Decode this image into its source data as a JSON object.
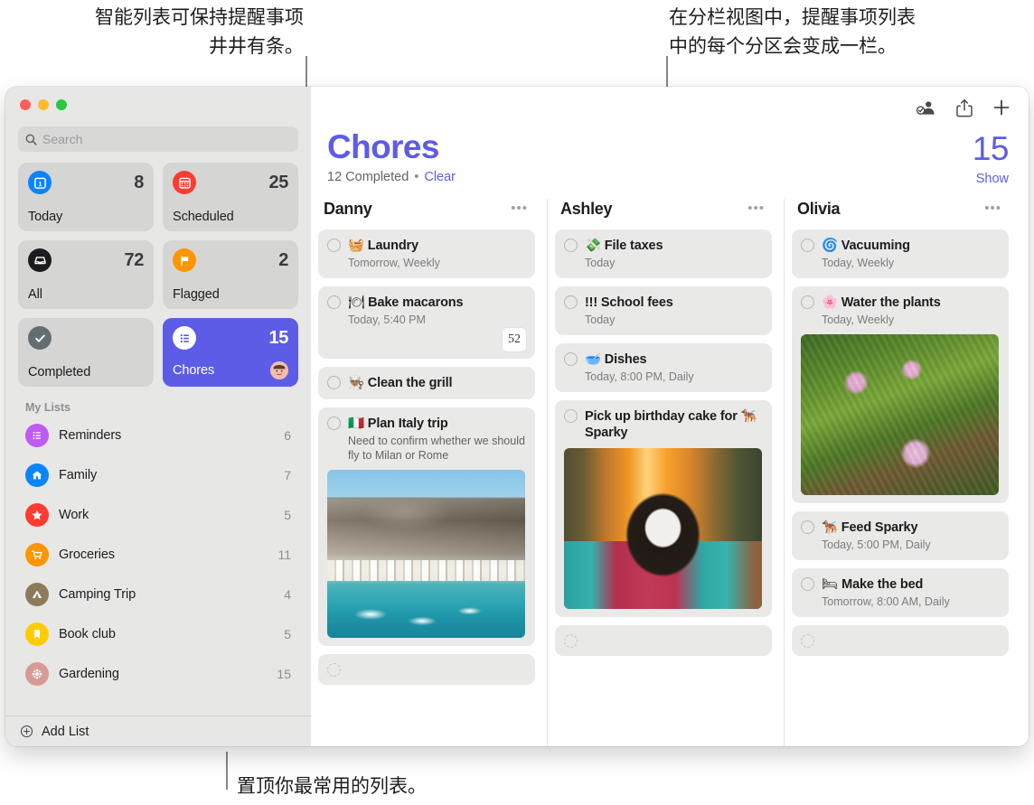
{
  "annotations": {
    "top_left": "智能列表可保持提醒事项\n井井有条。",
    "top_right": "在分栏视图中，提醒事项列表\n中的每个分区会变成一栏。",
    "bottom": "置顶你最常用的列表。"
  },
  "colors": {
    "accent": "#5D5CE6",
    "sidebar_bg": "#E7E7E5",
    "card_bg": "#E9E9E7"
  },
  "sidebar": {
    "search": {
      "placeholder": "Search",
      "value": "",
      "icon": "search-icon"
    },
    "smart_lists": [
      {
        "label": "Today",
        "count": "8",
        "icon": "calendar-day-icon",
        "color": "#0a84ff",
        "selected": false
      },
      {
        "label": "Scheduled",
        "count": "25",
        "icon": "calendar-icon",
        "color": "#ff3b30",
        "selected": false
      },
      {
        "label": "All",
        "count": "72",
        "icon": "tray-icon",
        "color": "#1c1c1e",
        "selected": false
      },
      {
        "label": "Flagged",
        "count": "2",
        "icon": "flag-icon",
        "color": "#ff9500",
        "selected": false
      },
      {
        "label": "Completed",
        "count": "",
        "icon": "checkmark-icon",
        "color": "#636e72",
        "selected": false
      },
      {
        "label": "Chores",
        "count": "15",
        "icon": "list-bullet-icon",
        "color": "#ffffff",
        "selected": true,
        "avatar": "shared-avatar"
      }
    ],
    "my_lists_header": "My Lists",
    "my_lists": [
      {
        "label": "Reminders",
        "count": "6",
        "icon": "list-bullet-icon",
        "color": "#bf5af2"
      },
      {
        "label": "Family",
        "count": "7",
        "icon": "house-icon",
        "color": "#0a84ff"
      },
      {
        "label": "Work",
        "count": "5",
        "icon": "star-icon",
        "color": "#ff3b30"
      },
      {
        "label": "Groceries",
        "count": "11",
        "icon": "cart-icon",
        "color": "#ff9500"
      },
      {
        "label": "Camping Trip",
        "count": "4",
        "icon": "tent-icon",
        "color": "#8c7a5b"
      },
      {
        "label": "Book club",
        "count": "5",
        "icon": "bookmark-icon",
        "color": "#ffcc00"
      },
      {
        "label": "Gardening",
        "count": "15",
        "icon": "flower-icon",
        "color": "#d89a95"
      }
    ],
    "add_list_label": "Add List",
    "add_list_icon": "plus-circle-icon"
  },
  "toolbar": {
    "share_people_icon": "add-person-icon",
    "share_icon": "share-icon",
    "add_icon": "plus-icon"
  },
  "header": {
    "title": "Chores",
    "completed_text": "12 Completed",
    "separator": "•",
    "clear_label": "Clear",
    "count": "15",
    "show_label": "Show"
  },
  "columns": [
    {
      "name": "Danny",
      "more_icon": "ellipsis-icon",
      "items": [
        {
          "emoji": "🧺",
          "title": "Laundry",
          "sub": "Tomorrow, Weekly"
        },
        {
          "emoji": "🍽",
          "title": "Bake macarons",
          "sub": "Today, 5:40 PM",
          "badge": "52"
        },
        {
          "emoji": "👨🏽‍🍳",
          "title": "Clean the grill"
        },
        {
          "emoji": "🇮🇹",
          "title": "Plan Italy trip",
          "note": "Need to confirm whether we should fly to Milan or Rome",
          "photo": "italy-coast-photo"
        },
        {
          "empty": true
        }
      ]
    },
    {
      "name": "Ashley",
      "more_icon": "ellipsis-icon",
      "items": [
        {
          "emoji": "💸",
          "title": "File taxes",
          "sub": "Today"
        },
        {
          "emoji": "",
          "title": "!!! School fees",
          "sub": "Today"
        },
        {
          "emoji": "🥣",
          "title": "Dishes",
          "sub": "Today, 8:00 PM, Daily"
        },
        {
          "emoji": "",
          "title": "Pick up birthday cake for 🐕‍🦺 Sparky",
          "photo": "dog-photo"
        },
        {
          "empty": true
        }
      ]
    },
    {
      "name": "Olivia",
      "more_icon": "ellipsis-icon",
      "items": [
        {
          "emoji": "🌀",
          "title": "Vacuuming",
          "sub": "Today, Weekly"
        },
        {
          "emoji": "🌸",
          "title": "Water the plants",
          "sub": "Today, Weekly",
          "photo": "flowers-photo"
        },
        {
          "emoji": "🐕‍🦺",
          "title": "Feed Sparky",
          "sub": "Today, 5:00 PM, Daily"
        },
        {
          "emoji": "🛏",
          "title": "Make the bed",
          "sub": "Tomorrow, 8:00 AM, Daily"
        },
        {
          "empty": true
        }
      ]
    }
  ]
}
